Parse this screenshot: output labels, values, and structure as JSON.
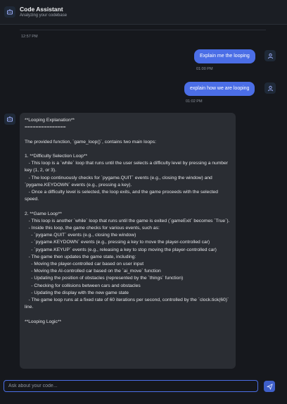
{
  "header": {
    "title": "Code Assistant",
    "subtitle": "Analyzing your codebase",
    "icon": "bot-icon"
  },
  "messages": {
    "prev_timestamp": "12:57 PM",
    "user1": {
      "text": "Explain me the looping",
      "timestamp": "01:00 PM"
    },
    "user2": {
      "text": "explain how we are looping",
      "timestamp": "01:02 PM"
    },
    "ai": {
      "text": "**Looping Explanation**\n===============\n\nThe provided function, `game_loop()`, contains two main loops:\n\n1. **Difficulty Selection Loop**\n   - This loop is a `while` loop that runs until the user selects a difficulty level by pressing a number key (1, 2, or 3).\n   - The loop continuously checks for `pygame.QUIT` events (e.g., closing the window) and `pygame.KEYDOWN` events (e.g., pressing a key).\n   - Once a difficulty level is selected, the loop exits, and the game proceeds with the selected speed.\n\n2. **Game Loop**\n   - This loop is another `while` loop that runs until the game is exited (`gameExit` becomes `True`).\n   - Inside this loop, the game checks for various events, such as:\n     - `pygame.QUIT` events (e.g., closing the window)\n     - `pygame.KEYDOWN` events (e.g., pressing a key to move the player-controlled car)\n     - `pygame.KEYUP` events (e.g., releasing a key to stop moving the player-controlled car)\n   - The game then updates the game state, including:\n     - Moving the player-controlled car based on user input\n     - Moving the AI-controlled car based on the `ai_move` function\n     - Updating the position of obstacles (represented by the `things` function)\n     - Checking for collisions between cars and obstacles\n     - Updating the display with the new game state\n   - The game loop runs at a fixed rate of 60 iterations per second, controlled by the `clock.tick(60)` line.\n\n**Looping Logic**"
    }
  },
  "composer": {
    "placeholder": "Ask about your code...",
    "send_icon": "send-icon"
  },
  "colors": {
    "accent": "#4b6ee6",
    "background": "#16181d",
    "card": "#2a2d33"
  }
}
